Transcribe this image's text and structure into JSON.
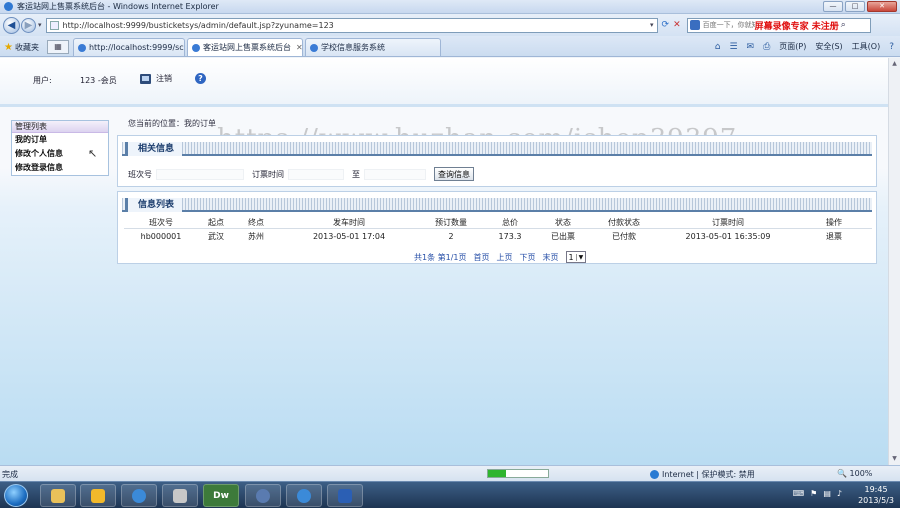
{
  "window": {
    "title": "客运站网上售票系统后台 - Windows Internet Explorer",
    "min": "—",
    "max": "□",
    "close": "✕"
  },
  "address": {
    "url": "http://localhost:9999/busticketsys/admin/default.jsp?zyuname=123"
  },
  "search": {
    "placeholder": "百度一下，你就知道",
    "overlay": "屏幕录像专家 未注册"
  },
  "favorites_label": "收藏夹",
  "tabs": [
    {
      "label": "http://localhost:9999/sc..."
    },
    {
      "label": "客运站网上售票系统后台"
    },
    {
      "label": "学校信息服务系统"
    }
  ],
  "commands": {
    "page": "页面(P)",
    "safety": "安全(S)",
    "tools": "工具(O)"
  },
  "header": {
    "user_label": "用户:",
    "user_value": "123 -会员",
    "logout": "注销"
  },
  "sidebar": {
    "title": "管理列表",
    "items": [
      {
        "label": "我的订单"
      },
      {
        "label": "修改个人信息"
      },
      {
        "label": "修改登录信息"
      }
    ]
  },
  "breadcrumb": "您当前的位置：我的订单",
  "watermark": "https://www.huzhan.com/ishop39397",
  "query": {
    "title": "相关信息",
    "bus_no_label": "班次号",
    "order_time_label": "订票时间",
    "to_label": "至",
    "button": "查询信息"
  },
  "list": {
    "title": "信息列表",
    "columns": [
      "班次号",
      "起点",
      "终点",
      "发车时间",
      "预订数量",
      "总价",
      "状态",
      "付款状态",
      "订票时间",
      "操作"
    ],
    "rows": [
      [
        "hb000001",
        "武汉",
        "苏州",
        "2013-05-01 17:04",
        "2",
        "173.3",
        "已出票",
        "已付款",
        "2013-05-01 16:35:09",
        "退票"
      ]
    ]
  },
  "pager": {
    "info": "共1条 第1/1页",
    "first": "首页",
    "prev": "上页",
    "next": "下页",
    "last": "末页",
    "page": "1"
  },
  "status": {
    "text": "完成",
    "zone": "Internet | 保护模式: 禁用",
    "zoom": "100%",
    "progress": 0.3
  },
  "taskbar": {
    "apps": [
      "Dw"
    ]
  },
  "clock": {
    "time": "19:45",
    "date": "2013/5/3"
  }
}
